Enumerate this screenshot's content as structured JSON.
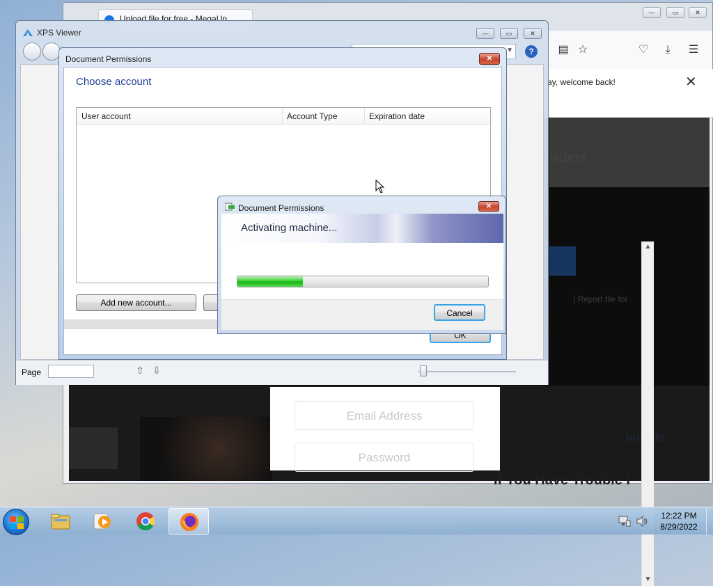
{
  "firefox": {
    "tab_title": "Upload file for free - MegaUp...",
    "notification": "ay, welcome back!",
    "close_glyph": "✕",
    "providers_text": "viders",
    "report_link": "|     Report file for",
    "email_placeholder": "Email Address",
    "password_placeholder": "Password",
    "partner_logo": "buyads",
    "bottom_heading": "If You Have Trouble F"
  },
  "xps": {
    "title": "XPS Viewer",
    "page_label": "Page"
  },
  "permissions": {
    "title": "Document Permissions",
    "heading": "Choose account",
    "columns": [
      "User account",
      "Account Type",
      "Expiration date"
    ],
    "add_button": "Add new account...",
    "ok_button": "OK"
  },
  "activating": {
    "title": "Document Permissions",
    "heading": "Activating machine...",
    "progress": 0.26,
    "cancel_button": "Cancel"
  },
  "taskbar": {
    "time": "12:22 PM",
    "date": "8/29/2022"
  },
  "colors": {
    "accent_blue": "#1e3f94",
    "progress_green": "#16b512",
    "close_red": "#c7442d"
  }
}
